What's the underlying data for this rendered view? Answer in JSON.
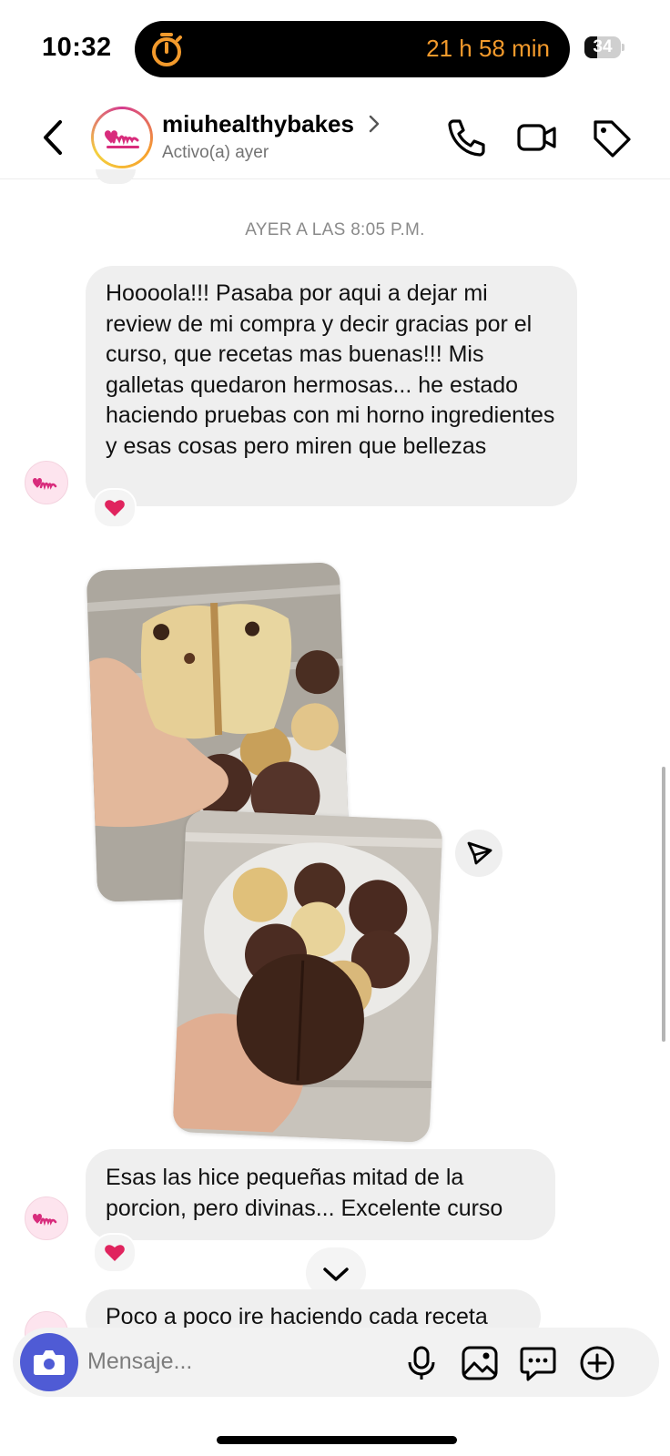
{
  "status_bar": {
    "time": "10:32",
    "live_activity_text": "21 h 58 min",
    "live_activity_color": "#f39a2c",
    "battery_level": "34",
    "battery_fraction": 0.34,
    "live_activity_icon": "stopwatch-icon"
  },
  "header": {
    "username": "miuhealthybakes",
    "status": "Activo(a) ayer",
    "avatar_ring_colors": [
      "#d43b8f",
      "#f7a12c",
      "#f4d03f"
    ],
    "icons": [
      "back-chevron-icon",
      "chevron-right-icon",
      "phone-icon",
      "video-camera-icon",
      "tag-icon"
    ]
  },
  "chat": {
    "timestamp": "AYER A LAS 8:05 P.M.",
    "messages": [
      {
        "text": "Hoooola!!! Pasaba por aqui a dejar mi review de mi compra y decir gracias por el  curso,  que recetas mas buenas!!! Mis galletas quedaron hermosas... he estado haciendo pruebas con mi horno ingredientes y esas cosas pero miren que bellezas",
        "reaction": "❤️"
      },
      {
        "type": "photos",
        "count": 2,
        "captions": [
          "cookies-split-in-hand-photo",
          "cookies-on-plate-photo"
        ]
      },
      {
        "text": "Esas las hice pequeñas mitad de la porcion, pero divinas... Excelente curso",
        "reaction": "❤️"
      },
      {
        "text": "Poco a poco ire haciendo cada receta"
      }
    ],
    "bubble_color": "#efefef",
    "reaction_color": "#e0245e"
  },
  "composer": {
    "placeholder": "Mensaje...",
    "value": "",
    "camera_color": "#4f5bd5",
    "icons": [
      "camera-icon",
      "microphone-icon",
      "image-icon",
      "sticker-chat-icon",
      "plus-circle-icon"
    ]
  }
}
